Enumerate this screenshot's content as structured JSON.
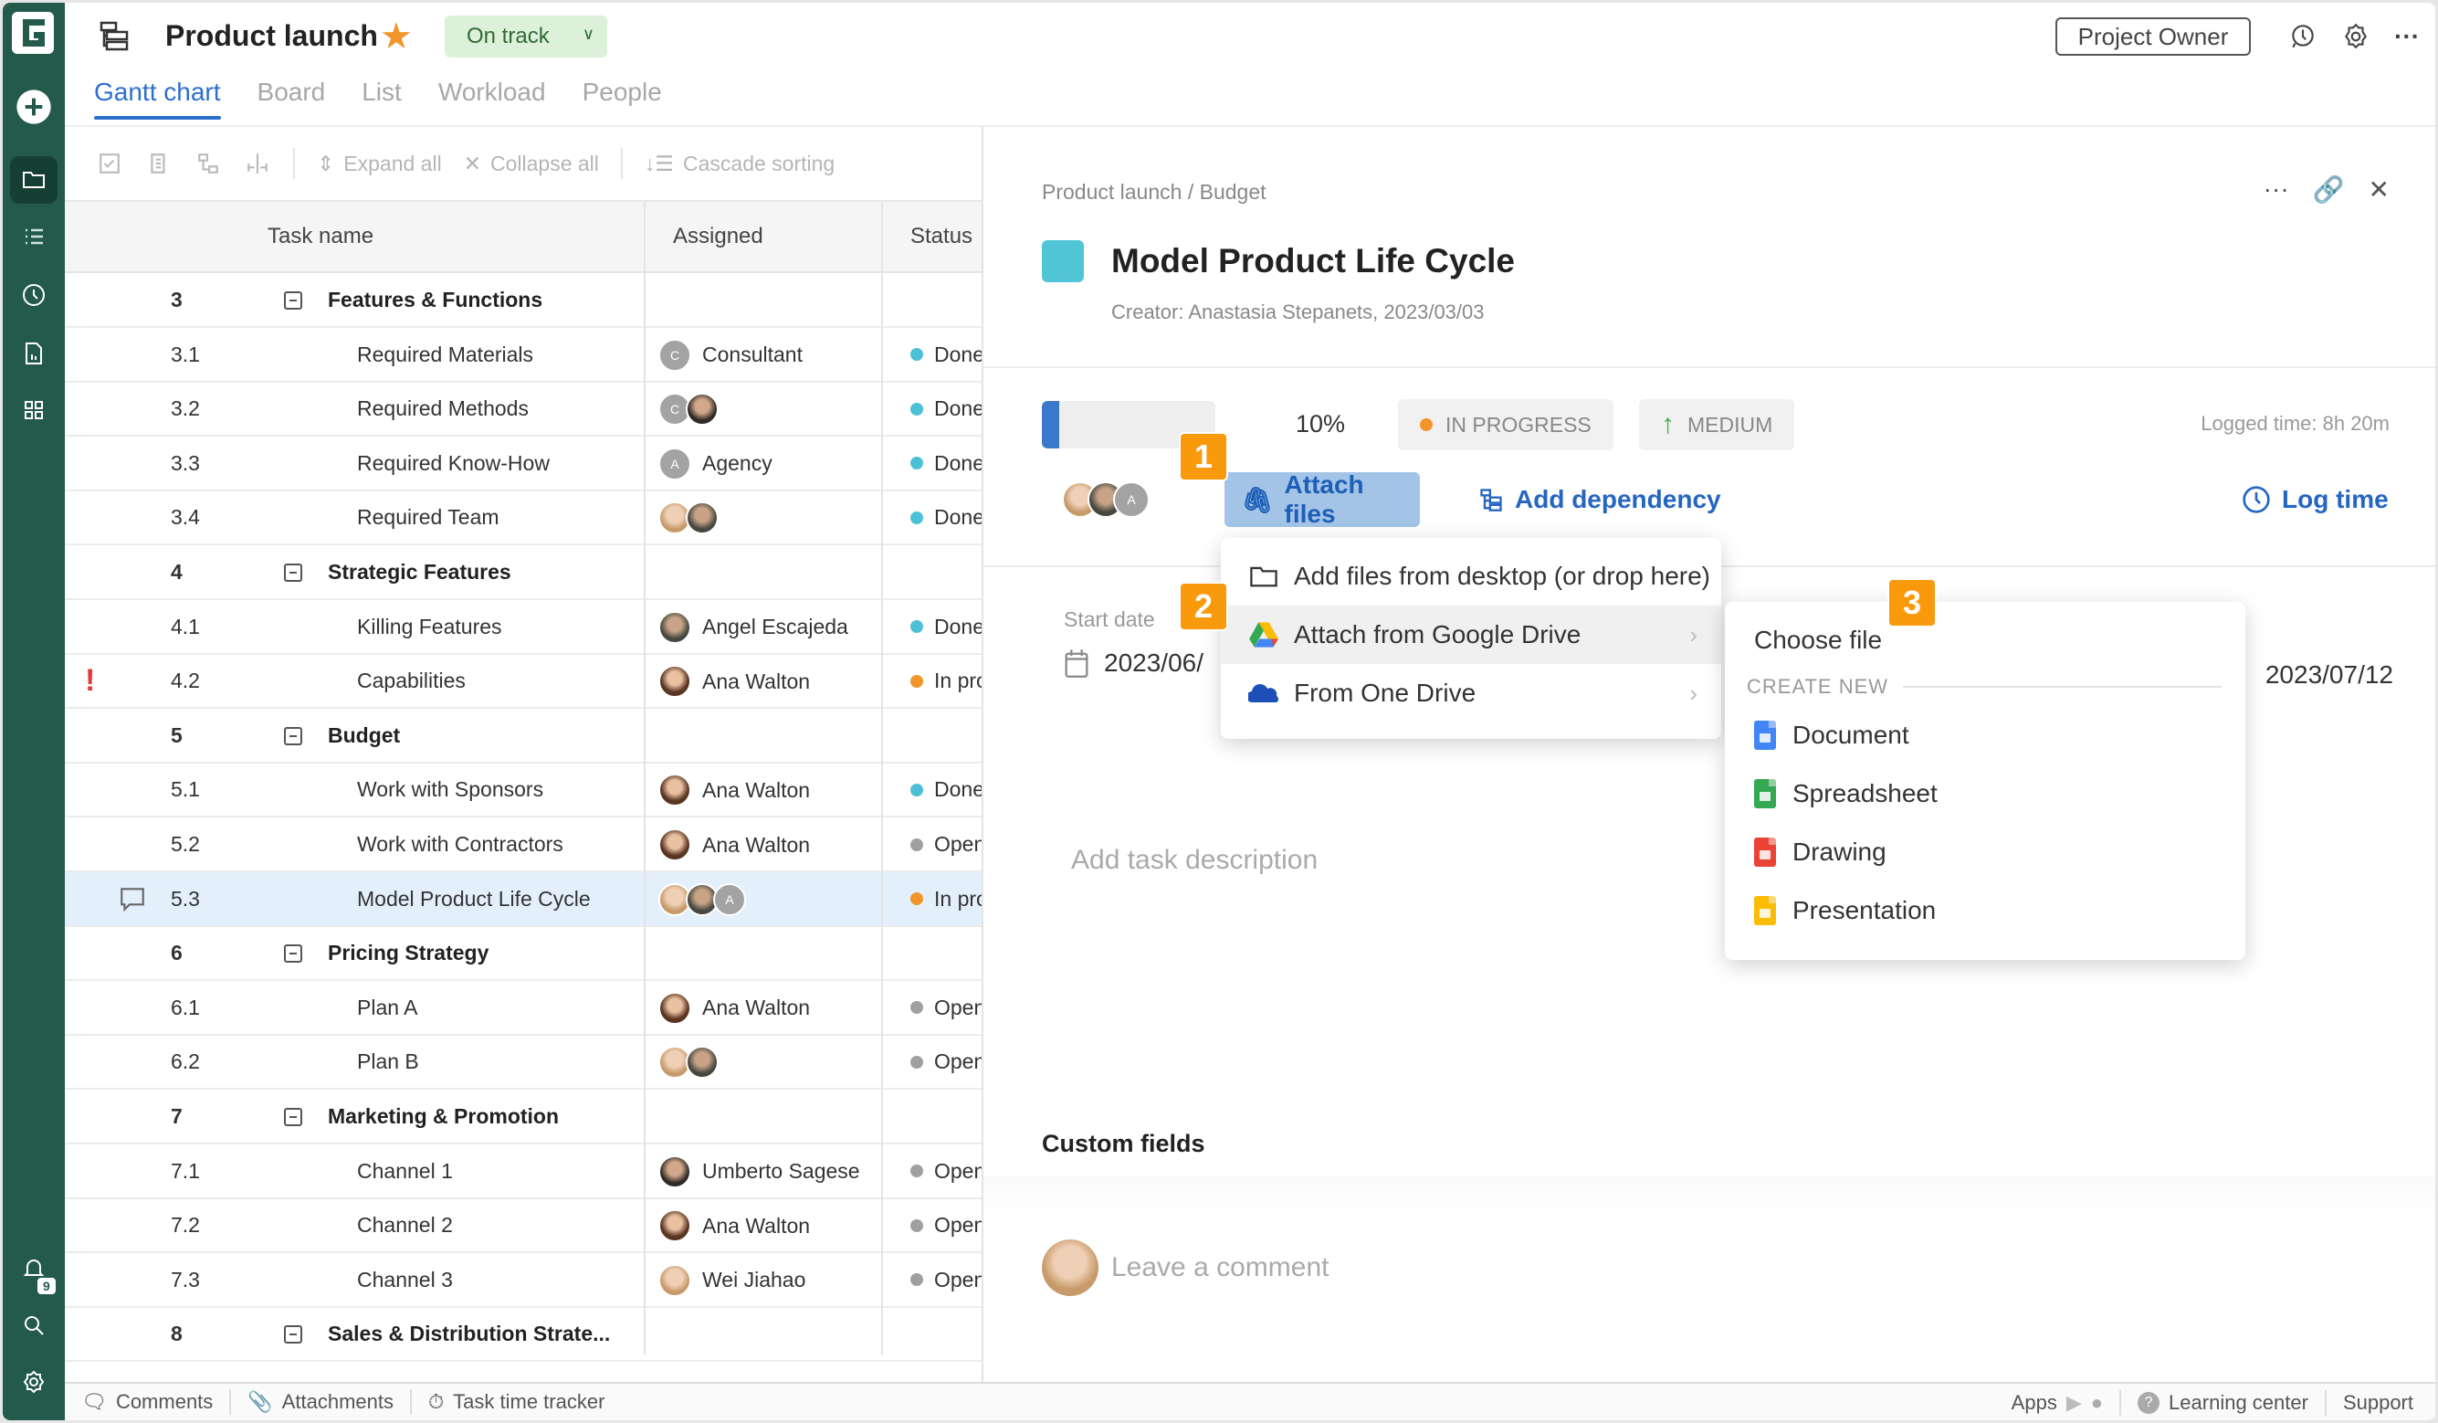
{
  "app": {
    "logo": "G"
  },
  "sidebar": {
    "items": [
      {
        "icon": "plus-circle-icon",
        "label": "Create"
      },
      {
        "icon": "folder-icon",
        "label": "Projects",
        "active": true
      },
      {
        "icon": "list-icon",
        "label": "Tasks"
      },
      {
        "icon": "clock-icon",
        "label": "Time"
      },
      {
        "icon": "report-icon",
        "label": "Reports"
      },
      {
        "icon": "apps-grid-icon",
        "label": "Apps"
      }
    ],
    "bottom": [
      {
        "icon": "bell-icon",
        "badge": "9"
      },
      {
        "icon": "search-icon"
      },
      {
        "icon": "gear-icon"
      }
    ]
  },
  "header": {
    "title": "Product launch",
    "status": "On track",
    "role": "Project Owner",
    "tabs": [
      {
        "label": "Gantt chart",
        "active": true
      },
      {
        "label": "Board"
      },
      {
        "label": "List"
      },
      {
        "label": "Workload"
      },
      {
        "label": "People"
      }
    ]
  },
  "toolbar": {
    "expand_all": "Expand all",
    "collapse_all": "Collapse all",
    "cascade_sorting": "Cascade sorting"
  },
  "grid": {
    "columns": {
      "task": "Task name",
      "assigned": "Assigned",
      "status": "Status"
    },
    "rows": [
      {
        "num": "3",
        "name": "Features & Functions",
        "group": true
      },
      {
        "num": "3.1",
        "name": "Required Materials",
        "assignee": "Consultant",
        "avatars": [
          "gray:C"
        ],
        "status": "Done",
        "status_color": "#4cc0d6"
      },
      {
        "num": "3.2",
        "name": "Required Methods",
        "assignee": "",
        "avatars": [
          "gray:C",
          "p2"
        ],
        "status": "Done",
        "status_color": "#4cc0d6"
      },
      {
        "num": "3.3",
        "name": "Required Know-How",
        "assignee": "Agency",
        "avatars": [
          "gray:A"
        ],
        "status": "Done",
        "status_color": "#4cc0d6"
      },
      {
        "num": "3.4",
        "name": "Required Team",
        "assignee": "",
        "avatars": [
          "p3",
          "p4"
        ],
        "status": "Done",
        "status_color": "#4cc0d6"
      },
      {
        "num": "4",
        "name": "Strategic Features",
        "group": true
      },
      {
        "num": "4.1",
        "name": "Killing Features",
        "assignee": "Angel Escajeda",
        "avatars": [
          "p4"
        ],
        "status": "Done",
        "status_color": "#4cc0d6"
      },
      {
        "num": "4.2",
        "name": "Capabilities",
        "assignee": "Ana Walton",
        "avatars": [
          "p1"
        ],
        "status": "In progress",
        "status_color": "#f2952a",
        "flag": "!"
      },
      {
        "num": "5",
        "name": "Budget",
        "group": true
      },
      {
        "num": "5.1",
        "name": "Work with Sponsors",
        "assignee": "Ana Walton",
        "avatars": [
          "p1"
        ],
        "status": "Done",
        "status_color": "#4cc0d6"
      },
      {
        "num": "5.2",
        "name": "Work with Contractors",
        "assignee": "Ana Walton",
        "avatars": [
          "p1"
        ],
        "status": "Open",
        "status_color": "#a0a0a0"
      },
      {
        "num": "5.3",
        "name": "Model Product Life Cycle",
        "assignee": "",
        "avatars": [
          "p3",
          "p4",
          "gray:A"
        ],
        "status": "In progress",
        "status_color": "#f2952a",
        "selected": true,
        "comment": true
      },
      {
        "num": "6",
        "name": "Pricing Strategy",
        "group": true
      },
      {
        "num": "6.1",
        "name": "Plan A",
        "assignee": "Ana Walton",
        "avatars": [
          "p1"
        ],
        "status": "Open",
        "status_color": "#a0a0a0"
      },
      {
        "num": "6.2",
        "name": "Plan B",
        "assignee": "",
        "avatars": [
          "p3",
          "p4"
        ],
        "status": "Open",
        "status_color": "#a0a0a0"
      },
      {
        "num": "7",
        "name": "Marketing & Promotion",
        "group": true
      },
      {
        "num": "7.1",
        "name": "Channel 1",
        "assignee": "Umberto Sagese",
        "avatars": [
          "p2"
        ],
        "status": "Open",
        "status_color": "#a0a0a0"
      },
      {
        "num": "7.2",
        "name": "Channel 2",
        "assignee": "Ana Walton",
        "avatars": [
          "p1"
        ],
        "status": "Open",
        "status_color": "#a0a0a0"
      },
      {
        "num": "7.3",
        "name": "Channel 3",
        "assignee": "Wei Jiahao",
        "avatars": [
          "p3"
        ],
        "status": "Open",
        "status_color": "#a0a0a0"
      },
      {
        "num": "8",
        "name": "Sales & Distribution Strate...",
        "group": true
      }
    ]
  },
  "bottombar": {
    "comments": "Comments",
    "attachments": "Attachments",
    "time_tracker": "Task time tracker",
    "apps": "Apps",
    "learning_center": "Learning center",
    "support": "Support"
  },
  "panel": {
    "breadcrumb": "Product launch / Budget",
    "title": "Model Product Life Cycle",
    "color": "#4fc5d6",
    "creator": "Creator: Anastasia Stepanets, 2023/03/03",
    "progress_percent": 10,
    "progress_label": "10%",
    "status": "IN PROGRESS",
    "priority": "MEDIUM",
    "logged_time": "Logged time: 8h 20m",
    "attach_files": "Attach files",
    "add_dependency": "Add dependency",
    "log_time": "Log time",
    "start_date_label": "Start date",
    "start_date": "2023/06/",
    "end_date": "2023/07/12",
    "description_placeholder": "Add task description",
    "custom_fields": "Custom fields",
    "comment_placeholder": "Leave a comment"
  },
  "attach_menu": {
    "items": [
      {
        "label": "Add files from desktop (or drop here)",
        "icon": "folder-icon"
      },
      {
        "label": "Attach from Google Drive",
        "icon": "google-drive-icon",
        "submenu": true,
        "hover": true
      },
      {
        "label": "From One Drive",
        "icon": "onedrive-icon",
        "submenu": true
      }
    ]
  },
  "drive_menu": {
    "choose_file": "Choose file",
    "create_new": "CREATE NEW",
    "items": [
      {
        "label": "Document",
        "color": "#4285f4"
      },
      {
        "label": "Spreadsheet",
        "color": "#34a853"
      },
      {
        "label": "Drawing",
        "color": "#ea4335"
      },
      {
        "label": "Presentation",
        "color": "#fbbc04"
      }
    ]
  },
  "markers": [
    "1",
    "2",
    "3"
  ]
}
